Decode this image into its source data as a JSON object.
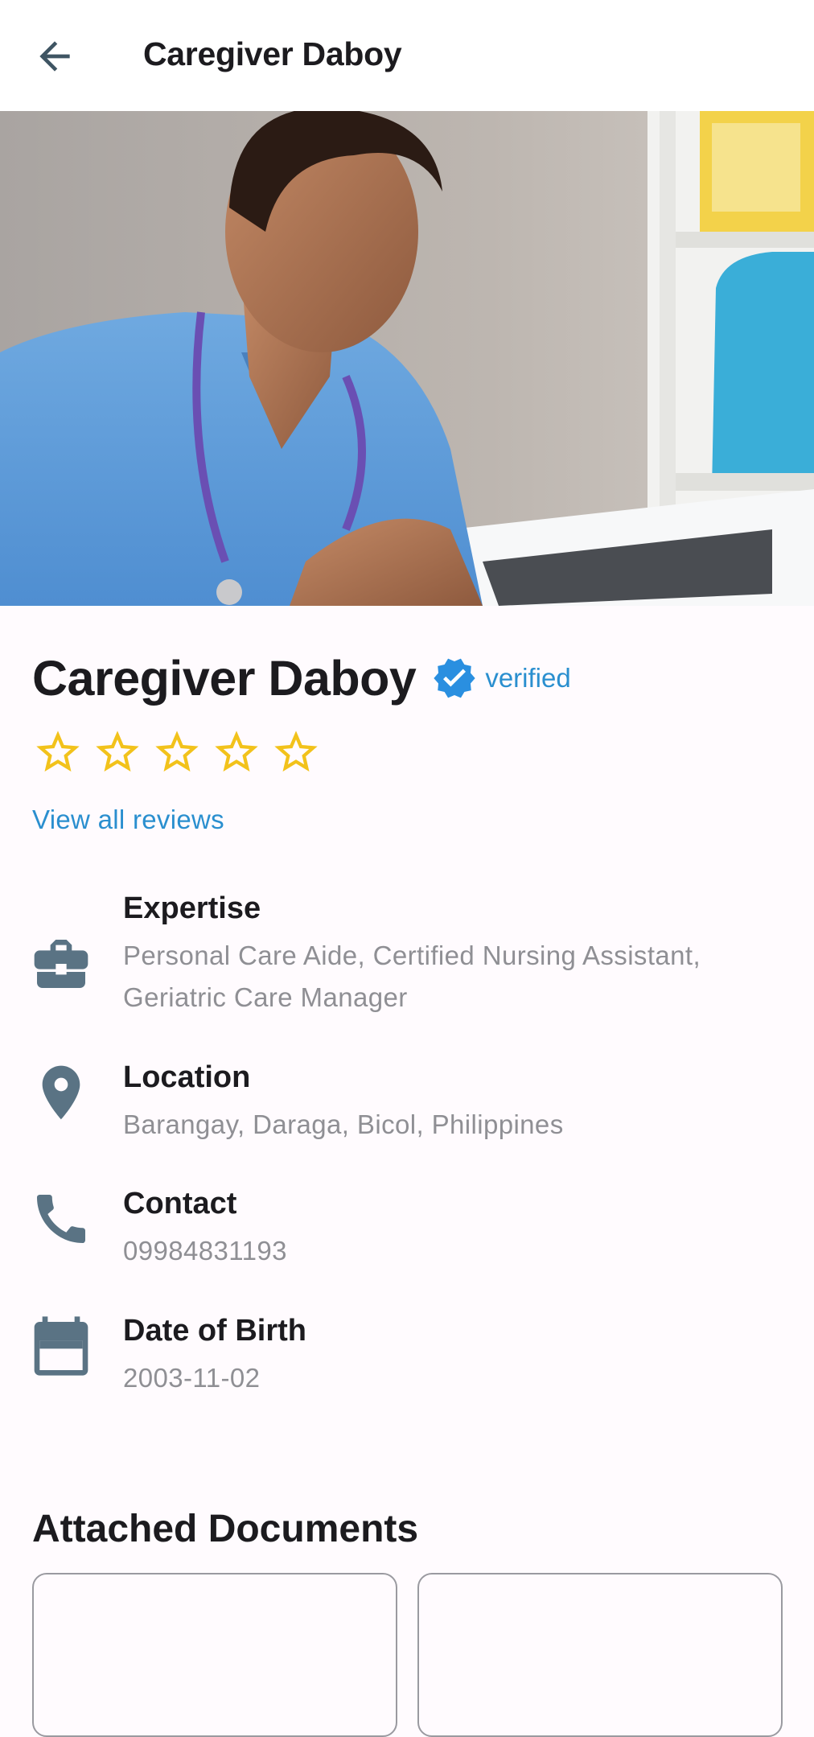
{
  "appbar": {
    "title": "Caregiver Daboy",
    "back_icon": "arrow-left-icon"
  },
  "profile": {
    "name": "Caregiver Daboy",
    "verified_label": "verified",
    "verified_icon": "verified-badge-icon",
    "rating": {
      "value": 0,
      "max": 5
    },
    "reviews_link": "View all reviews"
  },
  "details": [
    {
      "icon": "briefcase-icon",
      "title": "Expertise",
      "value": "Personal Care Aide, Certified Nursing Assistant, Geriatric Care Manager"
    },
    {
      "icon": "location-pin-icon",
      "title": "Location",
      "value": "Barangay, Daraga, Bicol, Philippines"
    },
    {
      "icon": "phone-icon",
      "title": "Contact",
      "value": "09984831193"
    },
    {
      "icon": "calendar-icon",
      "title": "Date of Birth",
      "value": "2003-11-02"
    }
  ],
  "documents": {
    "title": "Attached Documents"
  },
  "colors": {
    "accent": "#2a8fcf",
    "star": "#f2c21b",
    "icon": "#5a7384",
    "muted_text": "#8f8f94"
  }
}
